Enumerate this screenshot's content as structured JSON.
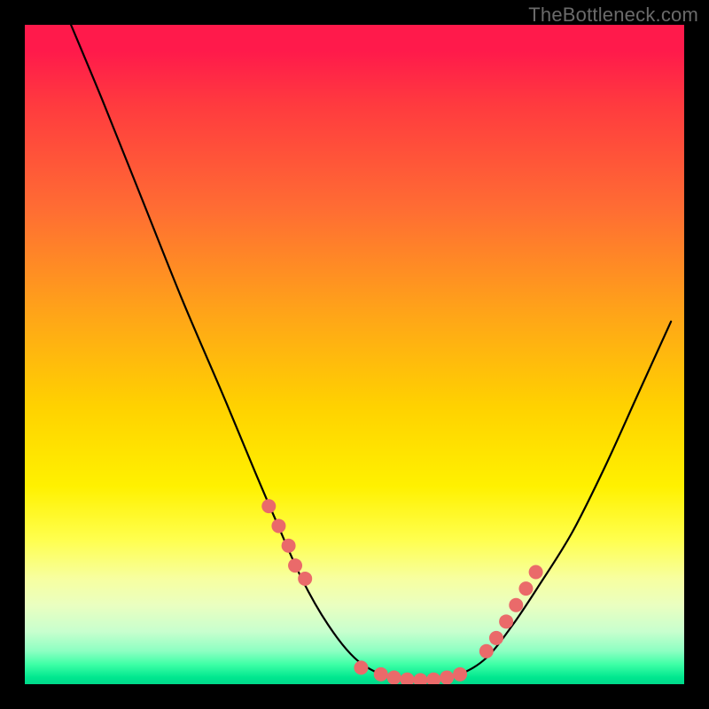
{
  "watermark": "TheBottleneck.com",
  "chart_data": {
    "type": "line",
    "title": "",
    "xlabel": "",
    "ylabel": "",
    "xlim": [
      0,
      100
    ],
    "ylim": [
      0,
      100
    ],
    "grid": false,
    "legend": false,
    "background_gradient": {
      "stops": [
        {
          "pos": 0.0,
          "color": "#ff1a4b"
        },
        {
          "pos": 0.5,
          "color": "#ffd200"
        },
        {
          "pos": 0.8,
          "color": "#ffff4d"
        },
        {
          "pos": 1.0,
          "color": "#00d88a"
        }
      ]
    },
    "series": [
      {
        "name": "curve",
        "color": "#000000",
        "x": [
          7,
          12,
          18,
          24,
          30,
          35,
          38,
          42,
          46,
          50,
          54,
          58,
          62,
          66,
          70,
          74,
          78,
          83,
          88,
          93,
          98
        ],
        "y": [
          100,
          88,
          73,
          58,
          44,
          32,
          25,
          16,
          9,
          4,
          1.5,
          0.5,
          0.5,
          1.5,
          4,
          9,
          15,
          23,
          33,
          44,
          55
        ]
      }
    ],
    "markers": {
      "name": "points",
      "color": "#ea6a6a",
      "radius_px": 8,
      "x": [
        37,
        38.5,
        40,
        41,
        42.5,
        51,
        54,
        56,
        58,
        60,
        62,
        64,
        66,
        70,
        71.5,
        73,
        74.5,
        76,
        77.5
      ],
      "y": [
        27,
        24,
        21,
        18,
        16,
        2.5,
        1.5,
        1,
        0.7,
        0.6,
        0.7,
        1,
        1.5,
        5,
        7,
        9.5,
        12,
        14.5,
        17
      ]
    }
  }
}
